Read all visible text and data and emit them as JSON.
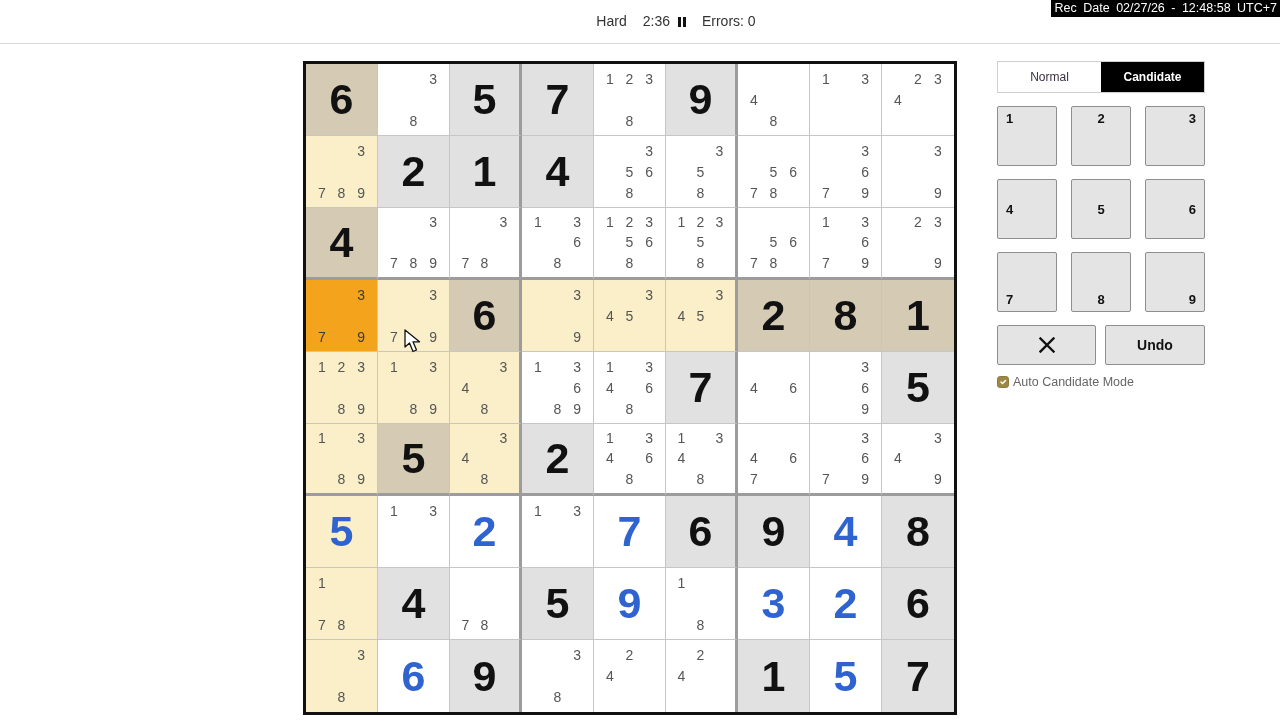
{
  "recording_overlay": "Rec Date 02/27/26 - 12:48:58 UTC+7",
  "header": {
    "difficulty": "Hard",
    "timer": "2:36",
    "errors": "Errors: 0"
  },
  "grid": {
    "rows": [
      [
        {
          "kind": "given",
          "value": "6",
          "selected": false
        },
        {
          "kind": "candidates",
          "candidates": [
            "3",
            "8"
          ],
          "selected": false
        },
        {
          "kind": "given",
          "value": "5",
          "selected": false
        },
        {
          "kind": "given",
          "value": "7",
          "selected": false
        },
        {
          "kind": "candidates",
          "candidates": [
            "1",
            "2",
            "3",
            "8"
          ],
          "selected": false
        },
        {
          "kind": "given",
          "value": "9",
          "selected": false
        },
        {
          "kind": "candidates",
          "candidates": [
            "4",
            "8"
          ],
          "selected": false
        },
        {
          "kind": "candidates",
          "candidates": [
            "1",
            "3"
          ],
          "selected": false
        },
        {
          "kind": "candidates",
          "candidates": [
            "2",
            "3",
            "4"
          ],
          "selected": false
        }
      ],
      [
        {
          "kind": "candidates",
          "candidates": [
            "3",
            "7",
            "8",
            "9"
          ],
          "selected": false
        },
        {
          "kind": "given",
          "value": "2",
          "selected": false
        },
        {
          "kind": "given",
          "value": "1",
          "selected": false
        },
        {
          "kind": "given",
          "value": "4",
          "selected": false
        },
        {
          "kind": "candidates",
          "candidates": [
            "3",
            "5",
            "6",
            "8"
          ],
          "selected": false
        },
        {
          "kind": "candidates",
          "candidates": [
            "3",
            "5",
            "8"
          ],
          "selected": false
        },
        {
          "kind": "candidates",
          "candidates": [
            "5",
            "6",
            "7",
            "8"
          ],
          "selected": false
        },
        {
          "kind": "candidates",
          "candidates": [
            "3",
            "6",
            "7",
            "9"
          ],
          "selected": false
        },
        {
          "kind": "candidates",
          "candidates": [
            "3",
            "9"
          ],
          "selected": false
        }
      ],
      [
        {
          "kind": "given",
          "value": "4",
          "selected": false
        },
        {
          "kind": "candidates",
          "candidates": [
            "3",
            "7",
            "8",
            "9"
          ],
          "selected": false
        },
        {
          "kind": "candidates",
          "candidates": [
            "3",
            "7",
            "8"
          ],
          "selected": false
        },
        {
          "kind": "candidates",
          "candidates": [
            "1",
            "3",
            "6",
            "8"
          ],
          "selected": false
        },
        {
          "kind": "candidates",
          "candidates": [
            "1",
            "2",
            "3",
            "5",
            "6",
            "8"
          ],
          "selected": false
        },
        {
          "kind": "candidates",
          "candidates": [
            "1",
            "2",
            "3",
            "5",
            "8"
          ],
          "selected": false
        },
        {
          "kind": "candidates",
          "candidates": [
            "5",
            "6",
            "7",
            "8"
          ],
          "selected": false
        },
        {
          "kind": "candidates",
          "candidates": [
            "1",
            "3",
            "6",
            "7",
            "9"
          ],
          "selected": false
        },
        {
          "kind": "candidates",
          "candidates": [
            "2",
            "3",
            "9"
          ],
          "selected": false
        }
      ],
      [
        {
          "kind": "candidates",
          "candidates": [
            "3",
            "7",
            "9"
          ],
          "selected": true
        },
        {
          "kind": "candidates",
          "candidates": [
            "3",
            "7",
            "9"
          ],
          "selected": false
        },
        {
          "kind": "given",
          "value": "6",
          "selected": false
        },
        {
          "kind": "candidates",
          "candidates": [
            "3",
            "9"
          ],
          "selected": false
        },
        {
          "kind": "candidates",
          "candidates": [
            "3",
            "4",
            "5"
          ],
          "selected": false
        },
        {
          "kind": "candidates",
          "candidates": [
            "3",
            "4",
            "5"
          ],
          "selected": false
        },
        {
          "kind": "given",
          "value": "2",
          "selected": false
        },
        {
          "kind": "given",
          "value": "8",
          "selected": false
        },
        {
          "kind": "given",
          "value": "1",
          "selected": false
        }
      ],
      [
        {
          "kind": "candidates",
          "candidates": [
            "1",
            "2",
            "3",
            "8",
            "9"
          ],
          "selected": false
        },
        {
          "kind": "candidates",
          "candidates": [
            "1",
            "3",
            "8",
            "9"
          ],
          "selected": false
        },
        {
          "kind": "candidates",
          "candidates": [
            "3",
            "4",
            "8"
          ],
          "selected": false
        },
        {
          "kind": "candidates",
          "candidates": [
            "1",
            "3",
            "6",
            "8",
            "9"
          ],
          "selected": false
        },
        {
          "kind": "candidates",
          "candidates": [
            "1",
            "3",
            "4",
            "6",
            "8"
          ],
          "selected": false
        },
        {
          "kind": "given",
          "value": "7",
          "selected": false
        },
        {
          "kind": "candidates",
          "candidates": [
            "4",
            "6"
          ],
          "selected": false
        },
        {
          "kind": "candidates",
          "candidates": [
            "3",
            "6",
            "9"
          ],
          "selected": false
        },
        {
          "kind": "given",
          "value": "5",
          "selected": false
        }
      ],
      [
        {
          "kind": "candidates",
          "candidates": [
            "1",
            "3",
            "8",
            "9"
          ],
          "selected": false
        },
        {
          "kind": "given",
          "value": "5",
          "selected": false
        },
        {
          "kind": "candidates",
          "candidates": [
            "3",
            "4",
            "8"
          ],
          "selected": false
        },
        {
          "kind": "given",
          "value": "2",
          "selected": false
        },
        {
          "kind": "candidates",
          "candidates": [
            "1",
            "3",
            "4",
            "6",
            "8"
          ],
          "selected": false
        },
        {
          "kind": "candidates",
          "candidates": [
            "1",
            "3",
            "4",
            "8"
          ],
          "selected": false
        },
        {
          "kind": "candidates",
          "candidates": [
            "4",
            "6",
            "7"
          ],
          "selected": false
        },
        {
          "kind": "candidates",
          "candidates": [
            "3",
            "6",
            "7",
            "9"
          ],
          "selected": false
        },
        {
          "kind": "candidates",
          "candidates": [
            "3",
            "4",
            "9"
          ],
          "selected": false
        }
      ],
      [
        {
          "kind": "entered",
          "value": "5",
          "selected": false
        },
        {
          "kind": "candidates",
          "candidates": [
            "1",
            "3"
          ],
          "selected": false
        },
        {
          "kind": "entered",
          "value": "2",
          "selected": false
        },
        {
          "kind": "candidates",
          "candidates": [
            "1",
            "3"
          ],
          "selected": false
        },
        {
          "kind": "entered",
          "value": "7",
          "selected": false
        },
        {
          "kind": "given",
          "value": "6",
          "selected": false
        },
        {
          "kind": "given",
          "value": "9",
          "selected": false
        },
        {
          "kind": "entered",
          "value": "4",
          "selected": false
        },
        {
          "kind": "given",
          "value": "8",
          "selected": false
        }
      ],
      [
        {
          "kind": "candidates",
          "candidates": [
            "1",
            "7",
            "8"
          ],
          "selected": false
        },
        {
          "kind": "given",
          "value": "4",
          "selected": false
        },
        {
          "kind": "candidates",
          "candidates": [
            "7",
            "8"
          ],
          "selected": false
        },
        {
          "kind": "given",
          "value": "5",
          "selected": false
        },
        {
          "kind": "entered",
          "value": "9",
          "selected": false
        },
        {
          "kind": "candidates",
          "candidates": [
            "1",
            "8"
          ],
          "selected": false
        },
        {
          "kind": "entered",
          "value": "3",
          "selected": false
        },
        {
          "kind": "entered",
          "value": "2",
          "selected": false
        },
        {
          "kind": "given",
          "value": "6",
          "selected": false
        }
      ],
      [
        {
          "kind": "candidates",
          "candidates": [
            "3",
            "8"
          ],
          "selected": false
        },
        {
          "kind": "entered",
          "value": "6",
          "selected": false
        },
        {
          "kind": "given",
          "value": "9",
          "selected": false
        },
        {
          "kind": "candidates",
          "candidates": [
            "3",
            "8"
          ],
          "selected": false
        },
        {
          "kind": "candidates",
          "candidates": [
            "2",
            "4"
          ],
          "selected": false
        },
        {
          "kind": "candidates",
          "candidates": [
            "2",
            "4"
          ],
          "selected": false
        },
        {
          "kind": "given",
          "value": "1",
          "selected": false
        },
        {
          "kind": "entered",
          "value": "5",
          "selected": false
        },
        {
          "kind": "given",
          "value": "7",
          "selected": false
        }
      ]
    ]
  },
  "mode_tabs": [
    {
      "label": "Normal",
      "selected": false
    },
    {
      "label": "Candidate",
      "selected": true
    }
  ],
  "keypad": [
    "1",
    "2",
    "3",
    "4",
    "5",
    "6",
    "7",
    "8",
    "9"
  ],
  "undo_button": {
    "label": "Undo"
  },
  "auto_candidate_mode": {
    "label": "Auto Candidate Mode",
    "checked": true
  }
}
